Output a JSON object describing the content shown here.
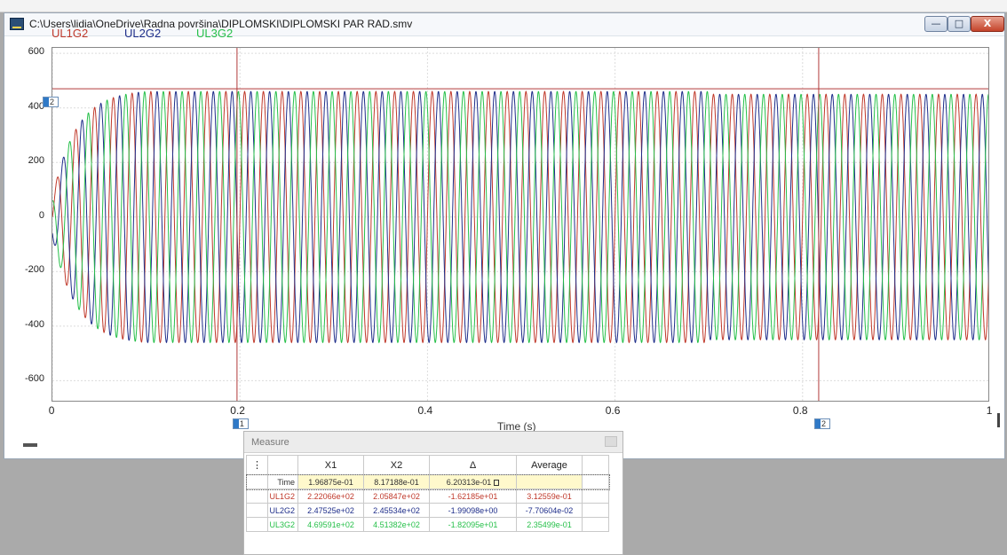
{
  "window": {
    "title": "C:\\Users\\lidia\\OneDrive\\Radna površina\\DIPLOMSKI\\DIPLOMSKI PAR RAD.smv",
    "min_glyph": "—",
    "max_glyph": "□",
    "close_glyph": "X"
  },
  "legend": [
    {
      "name": "UL1G2",
      "color": "#c0392b"
    },
    {
      "name": "UL2G2",
      "color": "#1f2e8a"
    },
    {
      "name": "UL3G2",
      "color": "#27c04a"
    }
  ],
  "chart_data": {
    "type": "line",
    "xlabel": "Time (s)",
    "ylabel": "",
    "xlim": [
      0,
      1
    ],
    "ylim": [
      -680,
      620
    ],
    "x_ticks": [
      "0",
      "0.2",
      "0.4",
      "0.6",
      "0.8",
      "1"
    ],
    "y_ticks": [
      "600",
      "400",
      "200",
      "0",
      "-200",
      "-400",
      "-600"
    ],
    "grid": true,
    "frequency_hz": 50,
    "series": [
      {
        "name": "UL1G2",
        "color": "#c0392b",
        "phase_deg": 0,
        "steady_amplitude": 460
      },
      {
        "name": "UL2G2",
        "color": "#1f2e8a",
        "phase_deg": -120,
        "steady_amplitude": 460
      },
      {
        "name": "UL3G2",
        "color": "#27c04a",
        "phase_deg": 120,
        "steady_amplitude": 460
      }
    ],
    "ramp_up_end_s": 0.1,
    "post_0_7_amplitude": 450,
    "horizontal_marker_y": 470,
    "cursors": [
      {
        "label": "1",
        "x": 0.196875
      },
      {
        "label": "2",
        "x": 0.817188
      }
    ]
  },
  "measure": {
    "title": "Measure",
    "menu_glyph": "⋮",
    "headers": [
      "X1",
      "X2",
      "Δ",
      "Average"
    ],
    "rows": [
      {
        "name": "Time",
        "x1": "1.96875e-01",
        "x2": "8.17188e-01",
        "delta": "6.20313e-01",
        "avg": "",
        "color": "#333333"
      },
      {
        "name": "UL1G2",
        "x1": "2.22066e+02",
        "x2": "2.05847e+02",
        "delta": "-1.62185e+01",
        "avg": "3.12559e-01",
        "color": "#c0392b"
      },
      {
        "name": "UL2G2",
        "x1": "2.47525e+02",
        "x2": "2.45534e+02",
        "delta": "-1.99098e+00",
        "avg": "-7.70604e-02",
        "color": "#1f2e8a"
      },
      {
        "name": "UL3G2",
        "x1": "4.69591e+02",
        "x2": "4.51382e+02",
        "delta": "-1.82095e+01",
        "avg": "2.35499e-01",
        "color": "#27c04a"
      }
    ]
  }
}
